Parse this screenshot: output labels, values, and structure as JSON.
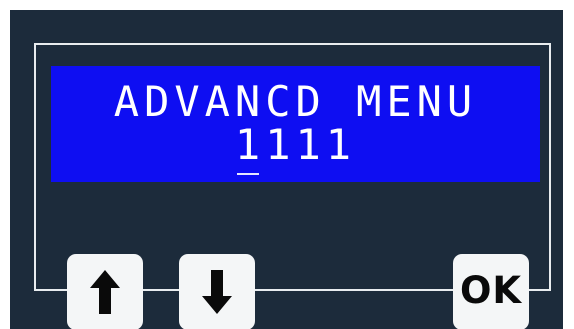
{
  "display": {
    "line1": "ADVANCD MENU",
    "pin": [
      "1",
      "1",
      "1",
      "1"
    ],
    "cursor_index": 0,
    "background_color": "#0e0ef2",
    "text_color": "#ffffff"
  },
  "keys": {
    "up_icon": "arrow-up-icon",
    "down_icon": "arrow-down-icon",
    "ok_label": "OK"
  },
  "colors": {
    "panel": "#1c2b3b",
    "key_face": "#f4f6f7",
    "frame_line": "#e8ecef"
  }
}
